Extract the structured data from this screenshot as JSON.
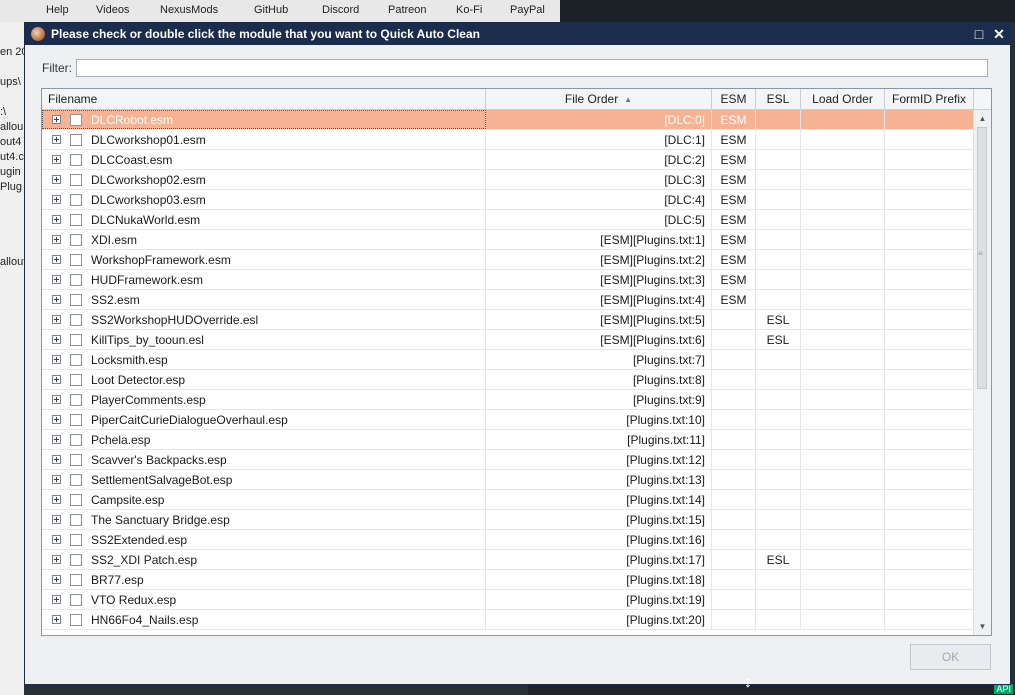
{
  "background": {
    "top_links": [
      "Help",
      "Videos",
      "NexusMods",
      "GitHub",
      "Discord",
      "Patreon",
      "Ko-Fi",
      "PayPal"
    ],
    "left_fragments": [
      "en 20",
      "ups\\",
      ":\\",
      "allou",
      "out4",
      "ut4.c",
      "ugin",
      "Plug",
      "allout"
    ],
    "badge": "API"
  },
  "dialog": {
    "title": "Please check or double click the module that you want to Quick Auto Clean",
    "filter_label": "Filter:",
    "filter_value": "",
    "ok_label": "OK"
  },
  "grid": {
    "columns": [
      "Filename",
      "File Order",
      "ESM",
      "ESL",
      "Load Order",
      "FormID Prefix"
    ],
    "sort_indicator": "▲",
    "rows": [
      {
        "filename": "DLCRobot.esm",
        "file_order": "[DLC:0]",
        "esm": "ESM",
        "esl": "",
        "load_order": "",
        "formid": ""
      },
      {
        "filename": "DLCworkshop01.esm",
        "file_order": "[DLC:1]",
        "esm": "ESM",
        "esl": "",
        "load_order": "",
        "formid": ""
      },
      {
        "filename": "DLCCoast.esm",
        "file_order": "[DLC:2]",
        "esm": "ESM",
        "esl": "",
        "load_order": "",
        "formid": ""
      },
      {
        "filename": "DLCworkshop02.esm",
        "file_order": "[DLC:3]",
        "esm": "ESM",
        "esl": "",
        "load_order": "",
        "formid": ""
      },
      {
        "filename": "DLCworkshop03.esm",
        "file_order": "[DLC:4]",
        "esm": "ESM",
        "esl": "",
        "load_order": "",
        "formid": ""
      },
      {
        "filename": "DLCNukaWorld.esm",
        "file_order": "[DLC:5]",
        "esm": "ESM",
        "esl": "",
        "load_order": "",
        "formid": ""
      },
      {
        "filename": "XDI.esm",
        "file_order": "[ESM][Plugins.txt:1]",
        "esm": "ESM",
        "esl": "",
        "load_order": "",
        "formid": ""
      },
      {
        "filename": "WorkshopFramework.esm",
        "file_order": "[ESM][Plugins.txt:2]",
        "esm": "ESM",
        "esl": "",
        "load_order": "",
        "formid": ""
      },
      {
        "filename": "HUDFramework.esm",
        "file_order": "[ESM][Plugins.txt:3]",
        "esm": "ESM",
        "esl": "",
        "load_order": "",
        "formid": ""
      },
      {
        "filename": "SS2.esm",
        "file_order": "[ESM][Plugins.txt:4]",
        "esm": "ESM",
        "esl": "",
        "load_order": "",
        "formid": ""
      },
      {
        "filename": "SS2WorkshopHUDOverride.esl",
        "file_order": "[ESM][Plugins.txt:5]",
        "esm": "",
        "esl": "ESL",
        "load_order": "",
        "formid": ""
      },
      {
        "filename": "KillTips_by_tooun.esl",
        "file_order": "[ESM][Plugins.txt:6]",
        "esm": "",
        "esl": "ESL",
        "load_order": "",
        "formid": ""
      },
      {
        "filename": "Locksmith.esp",
        "file_order": "[Plugins.txt:7]",
        "esm": "",
        "esl": "",
        "load_order": "",
        "formid": ""
      },
      {
        "filename": "Loot Detector.esp",
        "file_order": "[Plugins.txt:8]",
        "esm": "",
        "esl": "",
        "load_order": "",
        "formid": ""
      },
      {
        "filename": "PlayerComments.esp",
        "file_order": "[Plugins.txt:9]",
        "esm": "",
        "esl": "",
        "load_order": "",
        "formid": ""
      },
      {
        "filename": "PiperCaitCurieDialogueOverhaul.esp",
        "file_order": "[Plugins.txt:10]",
        "esm": "",
        "esl": "",
        "load_order": "",
        "formid": ""
      },
      {
        "filename": "Pchela.esp",
        "file_order": "[Plugins.txt:11]",
        "esm": "",
        "esl": "",
        "load_order": "",
        "formid": ""
      },
      {
        "filename": "Scavver's Backpacks.esp",
        "file_order": "[Plugins.txt:12]",
        "esm": "",
        "esl": "",
        "load_order": "",
        "formid": ""
      },
      {
        "filename": "SettlementSalvageBot.esp",
        "file_order": "[Plugins.txt:13]",
        "esm": "",
        "esl": "",
        "load_order": "",
        "formid": ""
      },
      {
        "filename": "Campsite.esp",
        "file_order": "[Plugins.txt:14]",
        "esm": "",
        "esl": "",
        "load_order": "",
        "formid": ""
      },
      {
        "filename": "The Sanctuary Bridge.esp",
        "file_order": "[Plugins.txt:15]",
        "esm": "",
        "esl": "",
        "load_order": "",
        "formid": ""
      },
      {
        "filename": "SS2Extended.esp",
        "file_order": "[Plugins.txt:16]",
        "esm": "",
        "esl": "",
        "load_order": "",
        "formid": ""
      },
      {
        "filename": "SS2_XDI Patch.esp",
        "file_order": "[Plugins.txt:17]",
        "esm": "",
        "esl": "ESL",
        "load_order": "",
        "formid": ""
      },
      {
        "filename": "BR77.esp",
        "file_order": "[Plugins.txt:18]",
        "esm": "",
        "esl": "",
        "load_order": "",
        "formid": ""
      },
      {
        "filename": "VTO Redux.esp",
        "file_order": "[Plugins.txt:19]",
        "esm": "",
        "esl": "",
        "load_order": "",
        "formid": ""
      },
      {
        "filename": "HN66Fo4_Nails.esp",
        "file_order": "[Plugins.txt:20]",
        "esm": "",
        "esl": "",
        "load_order": "",
        "formid": ""
      }
    ]
  }
}
